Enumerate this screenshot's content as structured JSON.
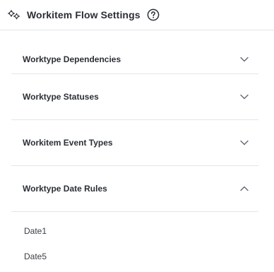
{
  "header": {
    "title": "Workitem Flow Settings",
    "settings_icon": "gears-icon",
    "help_icon": "help-circle-icon"
  },
  "sections": [
    {
      "label": "Worktype Dependencies",
      "expanded": false
    },
    {
      "label": "Worktype Statuses",
      "expanded": false
    },
    {
      "label": "Workitem Event Types",
      "expanded": false
    },
    {
      "label": "Worktype Date Rules",
      "expanded": true
    }
  ],
  "date_rules": {
    "items": [
      "Date1",
      "Date5"
    ]
  },
  "colors": {
    "text": "#2b2f36",
    "divider": "#e3e5e8",
    "icon": "#5f6670"
  }
}
